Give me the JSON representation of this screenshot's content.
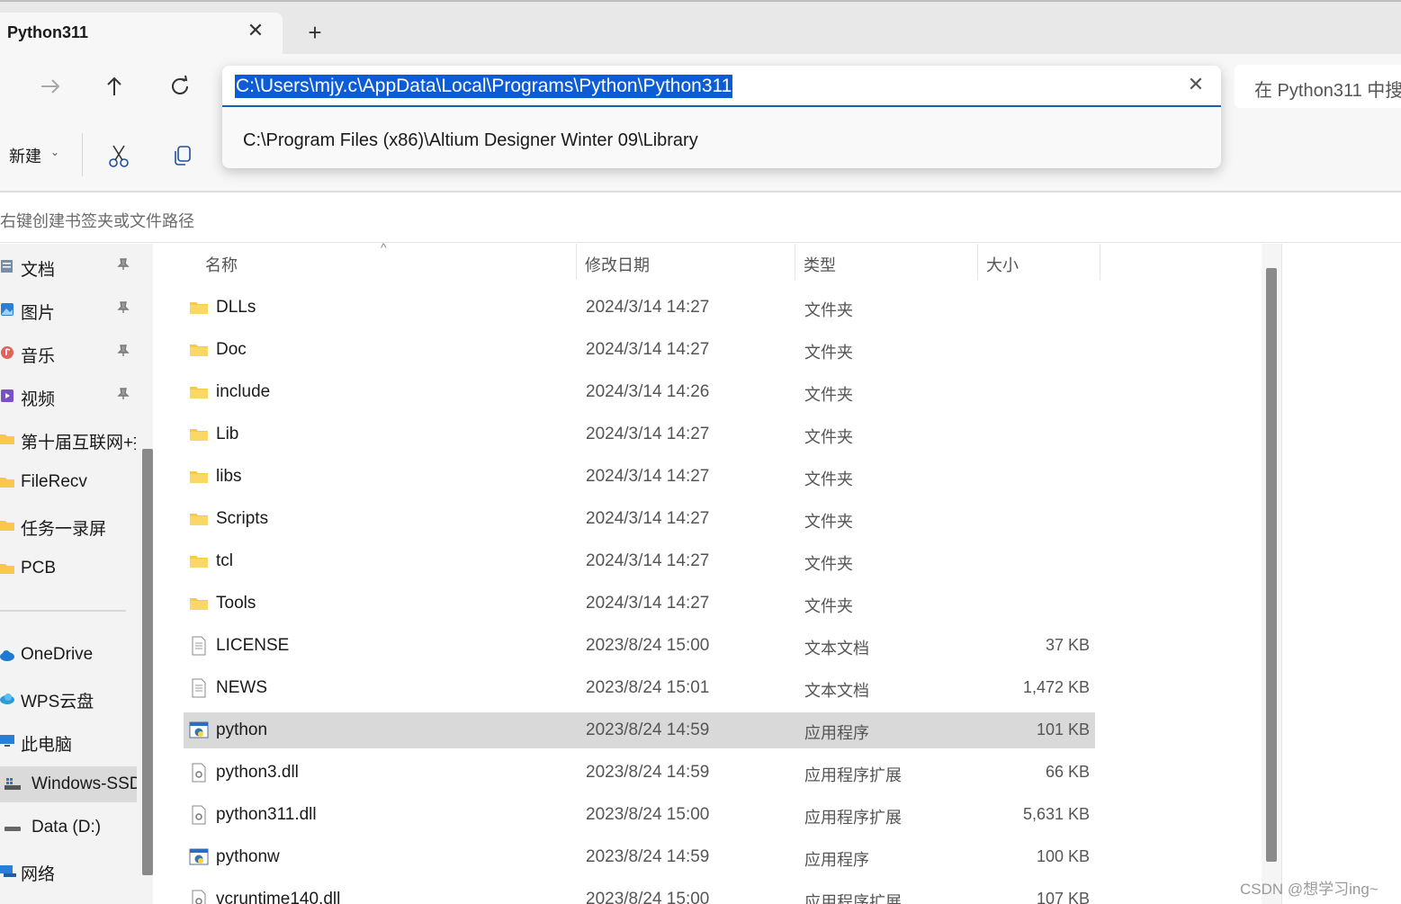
{
  "tab": {
    "title": "Python311",
    "close_glyph": "✕",
    "new_glyph": "+"
  },
  "nav": {
    "forward_icon": "arrow-right-icon",
    "up_icon": "arrow-up-icon",
    "refresh_icon": "refresh-icon"
  },
  "address": {
    "value": "C:\\Users\\mjy.c\\AppData\\Local\\Programs\\Python\\Python311",
    "clear_glyph": "✕",
    "suggestion": "C:\\Program Files (x86)\\Altium Designer Winter 09\\Library"
  },
  "search": {
    "placeholder": "在 Python311 中搜"
  },
  "command_bar": {
    "new_label": "新建",
    "new_caret": "⌄"
  },
  "bookmark_hint": "右键创建书签夹或文件路径",
  "sidebar": {
    "items": [
      {
        "label": "文档",
        "icon": "documents-icon",
        "pinned": true
      },
      {
        "label": "图片",
        "icon": "pictures-icon",
        "pinned": true
      },
      {
        "label": "音乐",
        "icon": "music-icon",
        "pinned": true
      },
      {
        "label": "视频",
        "icon": "videos-icon",
        "pinned": true
      },
      {
        "label": "第十届互联网+挑",
        "icon": "folder-icon",
        "pinned": false
      },
      {
        "label": "FileRecv",
        "icon": "folder-icon",
        "pinned": false
      },
      {
        "label": "任务一录屏",
        "icon": "folder-icon",
        "pinned": false
      },
      {
        "label": "PCB",
        "icon": "folder-icon",
        "pinned": false
      },
      {
        "label": "OneDrive",
        "icon": "onedrive-icon",
        "pinned": false
      },
      {
        "label": "WPS云盘",
        "icon": "wps-cloud-icon",
        "pinned": false
      },
      {
        "label": "此电脑",
        "icon": "this-pc-icon",
        "pinned": false
      },
      {
        "label": "Windows-SSD",
        "icon": "windows-drive-icon",
        "pinned": false,
        "selected": true
      },
      {
        "label": "Data (D:)",
        "icon": "drive-icon",
        "pinned": false
      },
      {
        "label": "网络",
        "icon": "network-icon",
        "pinned": false
      }
    ],
    "pin_glyph": "📌"
  },
  "columns": {
    "name": "名称",
    "date": "修改日期",
    "type": "类型",
    "size": "大小",
    "sort_glyph": "^"
  },
  "files": [
    {
      "name": "DLLs",
      "date": "2024/3/14 14:27",
      "type": "文件夹",
      "size": "",
      "kind": "folder"
    },
    {
      "name": "Doc",
      "date": "2024/3/14 14:27",
      "type": "文件夹",
      "size": "",
      "kind": "folder"
    },
    {
      "name": "include",
      "date": "2024/3/14 14:26",
      "type": "文件夹",
      "size": "",
      "kind": "folder"
    },
    {
      "name": "Lib",
      "date": "2024/3/14 14:27",
      "type": "文件夹",
      "size": "",
      "kind": "folder"
    },
    {
      "name": "libs",
      "date": "2024/3/14 14:27",
      "type": "文件夹",
      "size": "",
      "kind": "folder"
    },
    {
      "name": "Scripts",
      "date": "2024/3/14 14:27",
      "type": "文件夹",
      "size": "",
      "kind": "folder"
    },
    {
      "name": "tcl",
      "date": "2024/3/14 14:27",
      "type": "文件夹",
      "size": "",
      "kind": "folder"
    },
    {
      "name": "Tools",
      "date": "2024/3/14 14:27",
      "type": "文件夹",
      "size": "",
      "kind": "folder"
    },
    {
      "name": "LICENSE",
      "date": "2023/8/24 15:00",
      "type": "文本文档",
      "size": "37 KB",
      "kind": "text"
    },
    {
      "name": "NEWS",
      "date": "2023/8/24 15:01",
      "type": "文本文档",
      "size": "1,472 KB",
      "kind": "text"
    },
    {
      "name": "python",
      "date": "2023/8/24 14:59",
      "type": "应用程序",
      "size": "101 KB",
      "kind": "exe",
      "selected": true
    },
    {
      "name": "python3.dll",
      "date": "2023/8/24 14:59",
      "type": "应用程序扩展",
      "size": "66 KB",
      "kind": "dll"
    },
    {
      "name": "python311.dll",
      "date": "2023/8/24 15:00",
      "type": "应用程序扩展",
      "size": "5,631 KB",
      "kind": "dll"
    },
    {
      "name": "pythonw",
      "date": "2023/8/24 14:59",
      "type": "应用程序",
      "size": "100 KB",
      "kind": "exe"
    },
    {
      "name": "vcruntime140.dll",
      "date": "2023/8/24 15:00",
      "type": "应用程序扩展",
      "size": "107 KB",
      "kind": "dll"
    }
  ],
  "watermark": "CSDN @想学习ing~",
  "colors": {
    "selection": "#0b5cd5",
    "folder": "#f7c948",
    "accent": "#1a5fb4"
  }
}
